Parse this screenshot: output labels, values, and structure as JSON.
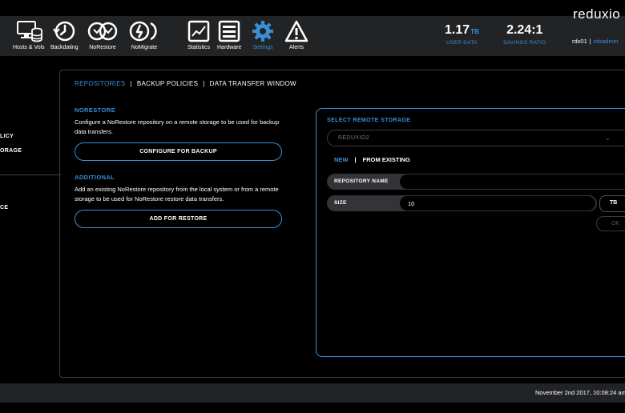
{
  "toolbar": {
    "items": [
      {
        "label": "Hosts & Vols",
        "icon": "hosts-volumes-icon"
      },
      {
        "label": "Backdating",
        "icon": "backdating-icon"
      },
      {
        "label": "NoRestore",
        "icon": "norestore-icon"
      },
      {
        "label": "NoMigrate",
        "icon": "nomigrate-icon"
      },
      {
        "label": "Statistics",
        "icon": "statistics-icon"
      },
      {
        "label": "Hardware",
        "icon": "hardware-icon"
      },
      {
        "label": "Settings",
        "icon": "settings-gear-icon"
      },
      {
        "label": "Alerts",
        "icon": "alerts-warning-icon"
      }
    ],
    "active": "Settings"
  },
  "stats": {
    "user_data": {
      "value": "1.17",
      "unit": "TB",
      "label": "USER DATA"
    },
    "savings_ratio": {
      "value": "2.24:1",
      "label": "SAVINGS RATIO"
    }
  },
  "brand": {
    "text": "reduxio"
  },
  "session": {
    "host": "rdx01",
    "separator": "|",
    "user": "rdxadmin"
  },
  "leftnav": {
    "items": [
      "LICY",
      "ORAGE",
      "CE"
    ]
  },
  "tabs": [
    {
      "label": "REPOSITORIES",
      "active": true
    },
    {
      "label": "BACKUP POLICIES",
      "active": false
    },
    {
      "label": "DATA TRANSFER WINDOW",
      "active": false
    }
  ],
  "tab_separator": "|",
  "norestore_section": {
    "title": "NORESTORE",
    "description": "Configure a NoRestore repository on a remote storage to be used for backup data transfers.",
    "button": "CONFIGURE FOR BACKUP"
  },
  "additional_section": {
    "title": "ADDITIONAL",
    "description": "Add an existing NoRestore repository from the local system or from a remote storage to be used for NoRestore restore data transfers.",
    "button": "ADD FOR RESTORE"
  },
  "remote_storage": {
    "title": "SELECT REMOTE STORAGE",
    "selected": "REDUXIO2",
    "mode_new": "NEW",
    "mode_separator": "|",
    "mode_existing": "FROM EXISTING",
    "repository_name": {
      "label": "REPOSITORY NAME",
      "value": ""
    },
    "size": {
      "label": "SIZE",
      "value": "10",
      "unit": "TB"
    },
    "ok_button": "OK"
  },
  "footer": {
    "timestamp": "November 2nd 2017, 10:08:24 am"
  },
  "colors": {
    "accent": "#3a8fd8",
    "toolbar_bg": "#222325",
    "page_bg": "#000000",
    "field_bg": "#333437"
  }
}
